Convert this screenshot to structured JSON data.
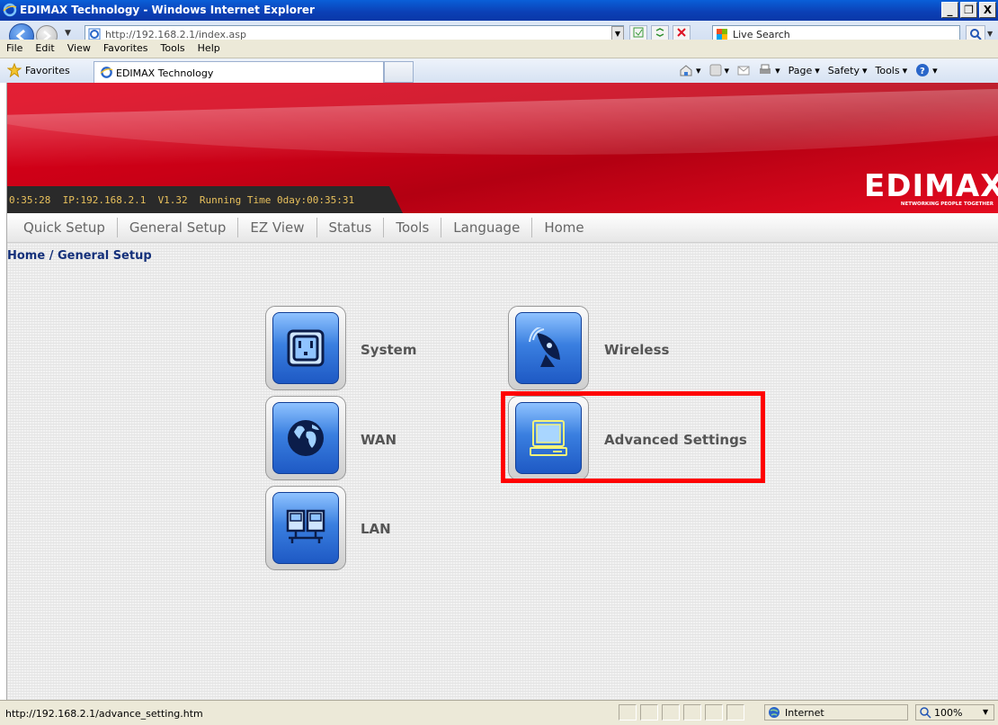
{
  "window": {
    "title": "EDIMAX Technology - Windows Internet Explorer",
    "controls": [
      "_",
      "&#x2752;",
      "X"
    ]
  },
  "address": {
    "url": "http://192.168.2.1/index.asp"
  },
  "search": {
    "placeholder": "Live Search"
  },
  "menu": {
    "items": [
      "File",
      "Edit",
      "View",
      "Favorites",
      "Tools",
      "Help"
    ]
  },
  "favorites": {
    "label": "Favorites",
    "tab_title": "EDIMAX Technology",
    "commands": [
      "Page",
      "Safety",
      "Tools"
    ]
  },
  "router": {
    "status_line": "0:35:28  IP:192.168.2.1  V1.32  Running Time 0day:00:35:31",
    "brand": "EDIMAX",
    "tagline": "NETWORKING PEOPLE TOGETHER",
    "nav": [
      "Quick Setup",
      "General Setup",
      "EZ View",
      "Status",
      "Tools",
      "Language",
      "Home"
    ],
    "breadcrumb": "Home / General Setup",
    "tiles": {
      "system": "System",
      "wan": "WAN",
      "lan": "LAN",
      "wireless": "Wireless",
      "advanced": "Advanced Settings"
    }
  },
  "statusbar": {
    "url": "http://192.168.2.1/advance_setting.htm",
    "zone": "Internet",
    "zoom": "100%"
  },
  "colors": {
    "highlight": "#ff0000",
    "banner_red": "#e2001a",
    "breadcrumb": "#14307a"
  }
}
